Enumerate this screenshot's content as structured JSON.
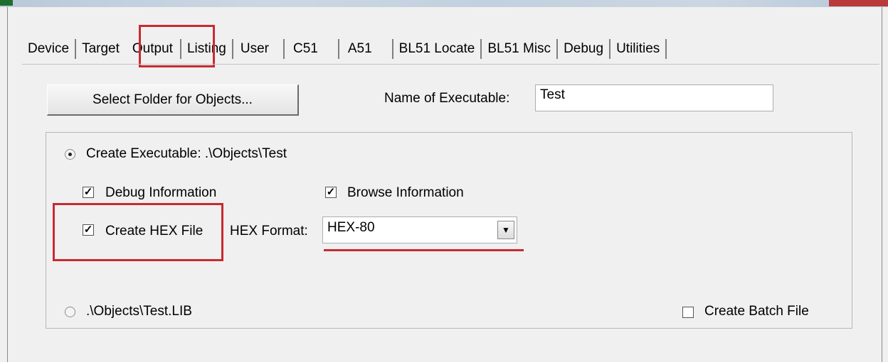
{
  "tabs": [
    "Device",
    "Target",
    "Output",
    "Listing",
    "User",
    "C51",
    "A51",
    "BL51 Locate",
    "BL51 Misc",
    "Debug",
    "Utilities"
  ],
  "active_tab": "Output",
  "select_folder_button": "Select Folder for Objects...",
  "executable_name_label": "Name of Executable:",
  "executable_name_value": "Test",
  "create_executable_label": "Create Executable:  .\\Objects\\Test",
  "debug_information_label": "Debug Information",
  "browse_information_label": "Browse Information",
  "create_hex_label": "Create HEX File",
  "hex_format_label": "HEX Format:",
  "hex_format_value": "HEX-80",
  "library_label": ".\\Objects\\Test.LIB",
  "create_batch_label": "Create Batch File",
  "annotation_color": "#c72a33"
}
